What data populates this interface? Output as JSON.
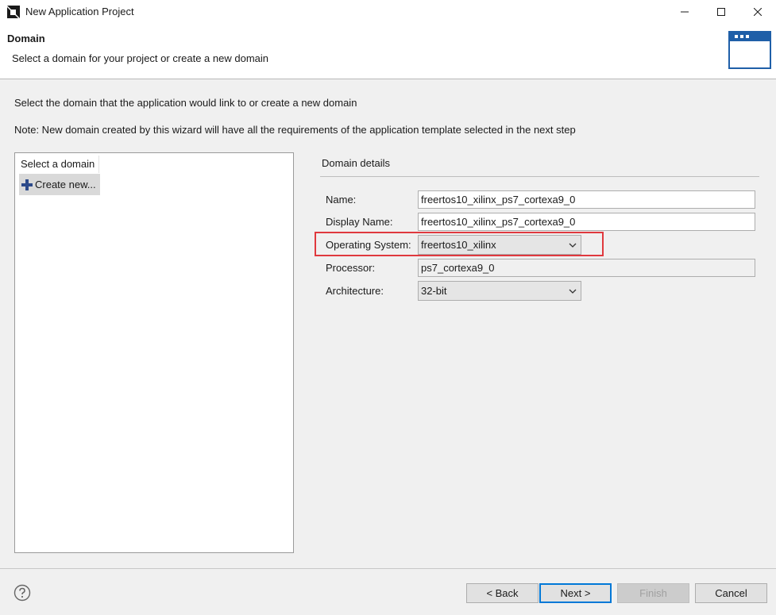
{
  "window": {
    "title": "New Application Project"
  },
  "header": {
    "title": "Domain",
    "description": "Select a domain for your project or create a new domain"
  },
  "body": {
    "instruction": "Select the domain that the application would link to or create a new domain",
    "note": "Note: New domain created by this wizard will have all the requirements of the application template selected in the next step"
  },
  "domain_list": {
    "header": "Select a domain",
    "items": [
      {
        "label": "Create new...",
        "icon": "plus-icon"
      }
    ]
  },
  "details": {
    "title": "Domain details",
    "name_label": "Name:",
    "name_value": "freertos10_xilinx_ps7_cortexa9_0",
    "display_name_label": "Display Name:",
    "display_name_value": "freertos10_xilinx_ps7_cortexa9_0",
    "os_label": "Operating System:",
    "os_value": "freertos10_xilinx",
    "processor_label": "Processor:",
    "processor_value": "ps7_cortexa9_0",
    "arch_label": "Architecture:",
    "arch_value": "32-bit"
  },
  "footer": {
    "back_label": "< Back",
    "next_label": "Next >",
    "finish_label": "Finish",
    "cancel_label": "Cancel"
  },
  "colors": {
    "highlight": "#e0393e",
    "accent": "#0078d7",
    "banner_blue": "#1f5fa8"
  },
  "icons": [
    "app-logo-icon",
    "minimize-icon",
    "maximize-icon",
    "close-icon",
    "wizard-banner-icon",
    "plus-icon",
    "chevron-down-icon",
    "help-icon"
  ]
}
